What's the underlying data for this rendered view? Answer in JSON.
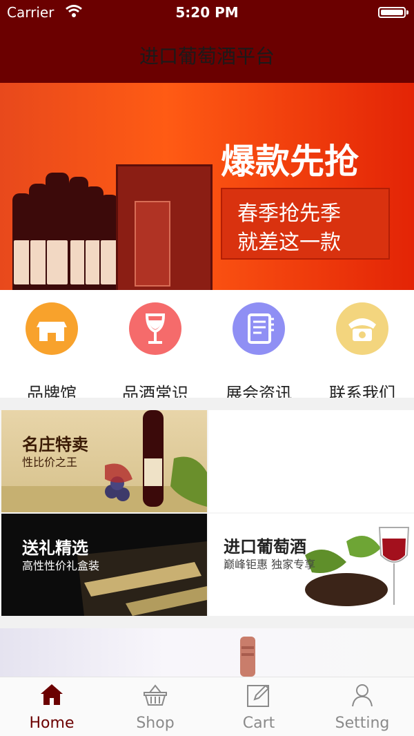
{
  "status_bar": {
    "carrier": "Carrier",
    "time": "5:20 PM"
  },
  "nav": {
    "title": "进口葡萄酒平台"
  },
  "banner": {
    "headline": "爆款先抢",
    "line1": "春季抢先季",
    "line2": "就差这一款"
  },
  "categories": [
    {
      "label": "品牌馆",
      "color": "#f8a22c",
      "icon": "storefront-icon"
    },
    {
      "label": "品酒常识",
      "color": "#f56b6b",
      "icon": "wine-glass-icon"
    },
    {
      "label": "展会资讯",
      "color": "#8f8ff4",
      "icon": "notebook-icon"
    },
    {
      "label": "联系我们",
      "color": "#f3d57e",
      "icon": "telephone-icon"
    }
  ],
  "tiles": [
    {
      "title": "名庄特卖",
      "subtitle": "性比价之王"
    },
    {
      "title": "送礼精选",
      "subtitle": "高性性价礼盒装"
    },
    {
      "title": "进口葡萄酒",
      "subtitle": "巅峰钜惠 独家专享"
    }
  ],
  "tabs": [
    {
      "label": "Home",
      "active": true,
      "icon": "home-icon"
    },
    {
      "label": "Shop",
      "active": false,
      "icon": "basket-icon"
    },
    {
      "label": "Cart",
      "active": false,
      "icon": "edit-icon"
    },
    {
      "label": "Setting",
      "active": false,
      "icon": "person-icon"
    }
  ],
  "colors": {
    "header": "#6b0000",
    "tab_active": "#6b0000",
    "tab_inactive": "#8a8a8a"
  }
}
